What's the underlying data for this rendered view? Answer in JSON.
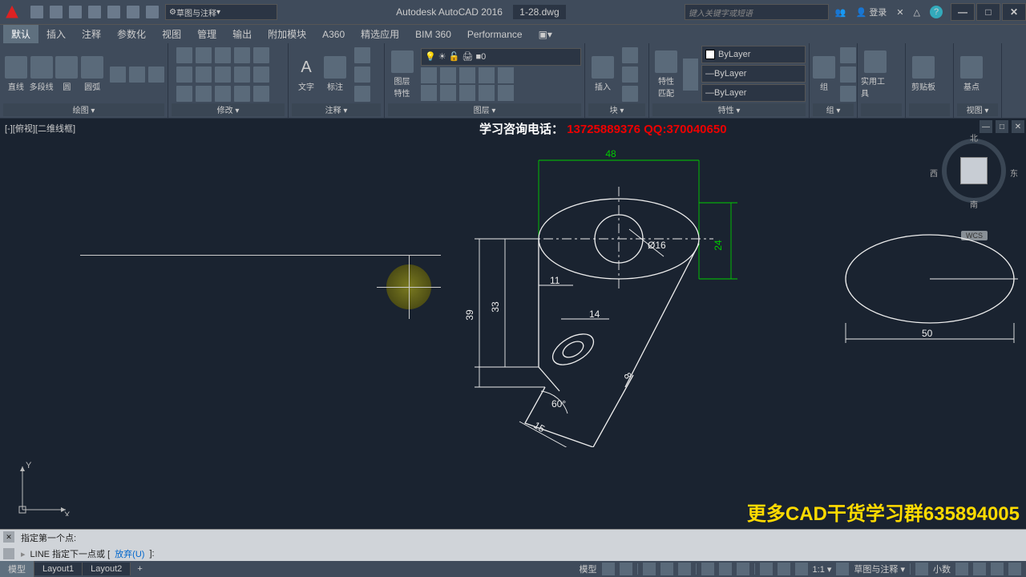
{
  "titlebar": {
    "app_name": "Autodesk AutoCAD 2016",
    "file_name": "1-28.dwg",
    "workspace_dd": "草图与注释",
    "search_placeholder": "键入关键字或短语",
    "login": "登录",
    "win_min": "—",
    "win_max": "□",
    "win_close": "✕"
  },
  "menubar": {
    "tabs": [
      "默认",
      "插入",
      "注释",
      "参数化",
      "视图",
      "管理",
      "输出",
      "附加模块",
      "A360",
      "精选应用",
      "BIM 360",
      "Performance"
    ]
  },
  "ribbon": {
    "draw": {
      "label": "绘图 ▾",
      "line": "直线",
      "pline": "多段线",
      "circle": "圆",
      "arc": "圆弧"
    },
    "modify": {
      "label": "修改 ▾"
    },
    "annot": {
      "label": "注释 ▾",
      "text": "文字",
      "dim": "标注"
    },
    "layers": {
      "label": "图层 ▾",
      "prop": "图层\n特性",
      "current": "0"
    },
    "block": {
      "label": "块 ▾",
      "insert": "插入"
    },
    "props": {
      "label": "特性 ▾",
      "match": "特性\n匹配",
      "bylayer": "ByLayer"
    },
    "group": {
      "label": "组 ▾",
      "g": "组"
    },
    "util": {
      "label": "",
      "u": "实用工具"
    },
    "clip": {
      "label": "",
      "c": "剪贴板"
    },
    "view": {
      "label": "视图 ▾",
      "b": "基点"
    }
  },
  "drawing": {
    "view_label": "[-][俯视][二维线框]",
    "contact": {
      "label": "学习咨询电话：",
      "phone": "13725889376",
      "qq": "QQ:370040650"
    },
    "banner": "更多CAD干货学习群635894005",
    "nav": {
      "n": "北",
      "s": "南",
      "e": "东",
      "w": "西"
    },
    "wcs": "WCS",
    "ucs": {
      "x": "X",
      "y": "Y"
    },
    "dims": {
      "d48": "48",
      "d24": "24",
      "d16": "Ø16",
      "d33": "33",
      "d39": "39",
      "d11": "11",
      "d14": "14",
      "d8": "8",
      "d60": "60°",
      "d15": "15",
      "d50": "50"
    }
  },
  "cmdbar": {
    "line1": "指定第一个点:",
    "line2_pre": "LINE 指定下一点或 [",
    "line2_opt": "放弃(U)",
    "line2_post": "]:"
  },
  "statusbar": {
    "tabs": [
      "模型",
      "Layout1",
      "Layout2"
    ],
    "plus": "+",
    "model": "模型",
    "scale": "1:1 ▾",
    "anno": "草图与注释 ▾",
    "dec": "小数"
  }
}
